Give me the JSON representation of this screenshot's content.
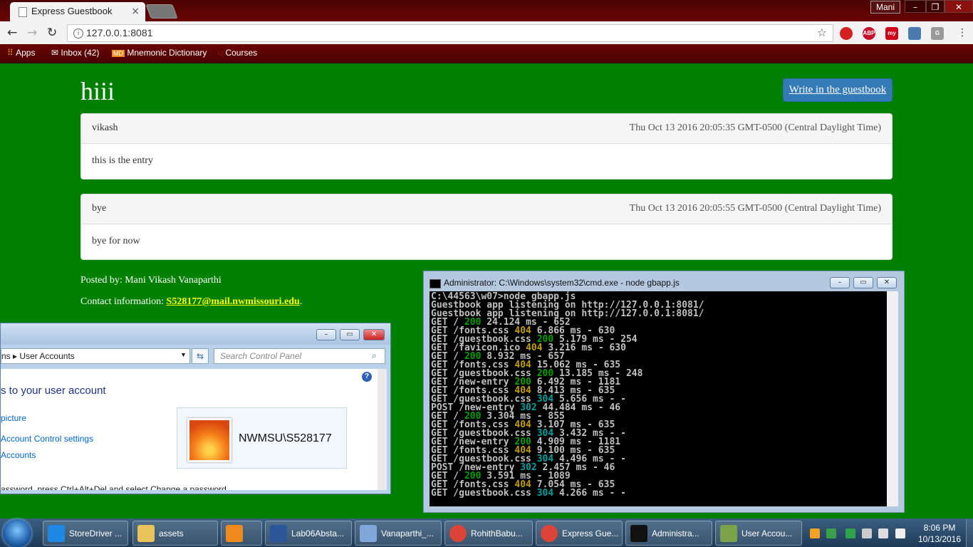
{
  "browser": {
    "tab_title": "Express Guestbook",
    "tab_close": "×",
    "user": "Mani",
    "url": "127.0.0.1:8081",
    "bookmarks": [
      {
        "label": "Apps"
      },
      {
        "label": "Inbox (42)"
      },
      {
        "label": "Mnemonic Dictionary"
      },
      {
        "label": "Courses"
      }
    ],
    "extensions": [
      "ABP",
      "my",
      "G"
    ]
  },
  "page": {
    "title": "hiii",
    "write_button": "Write in the guestbook",
    "entries": [
      {
        "name": "vikash",
        "date": "Thu Oct 13 2016 20:05:35 GMT-0500 (Central Daylight Time)",
        "body": "this is the entry"
      },
      {
        "name": "bye",
        "date": "Thu Oct 13 2016 20:05:55 GMT-0500 (Central Daylight Time)",
        "body": "bye for now"
      }
    ],
    "posted_by": "Posted by: Mani Vikash Vanaparthi",
    "contact_label": "Contact information: ",
    "contact_email": "S528177@mail.nwmissouri.edu",
    "contact_suffix": "."
  },
  "control_panel": {
    "breadcrumb_prefix": "ns",
    "breadcrumb_sep": "▸",
    "breadcrumb": "User Accounts",
    "search_placeholder": "Search Control Panel",
    "heading": "s to your user account",
    "links": [
      "picture",
      "Account Control settings",
      "Accounts"
    ],
    "bottom_text": "assword, press Ctrl+Alt+Del and select Change a password.",
    "account_name": "NWMSU\\S528177"
  },
  "cmd": {
    "title": "Administrator: C:\\Windows\\system32\\cmd.exe - node  gbapp.js",
    "lines": [
      {
        "text": "C:\\44563\\w07>node gbapp.js"
      },
      {
        "text": "Guestbook app listening on http://127.0.0.1:8081/"
      },
      {
        "text": "Guestbook app listening on http://127.0.0.1:8081/"
      },
      {
        "pre": "GET / ",
        "code": "200",
        "post": " 24.124 ms - 652"
      },
      {
        "pre": "GET /fonts.css ",
        "code": "404",
        "post": " 6.866 ms - 630"
      },
      {
        "pre": "GET /guestbook.css ",
        "code": "200",
        "post": " 5.179 ms - 254"
      },
      {
        "pre": "GET /favicon.ico ",
        "code": "404",
        "post": " 3.216 ms - 630"
      },
      {
        "pre": "GET / ",
        "code": "200",
        "post": " 8.932 ms - 657"
      },
      {
        "pre": "GET /fonts.css ",
        "code": "404",
        "post": " 15.062 ms - 635"
      },
      {
        "pre": "GET /guestbook.css ",
        "code": "200",
        "post": " 13.185 ms - 248"
      },
      {
        "pre": "GET /new-entry ",
        "code": "200",
        "post": " 6.492 ms - 1181"
      },
      {
        "pre": "GET /fonts.css ",
        "code": "404",
        "post": " 8.413 ms - 635"
      },
      {
        "pre": "GET /guestbook.css ",
        "code": "304",
        "post": " 5.656 ms - -"
      },
      {
        "pre": "POST /new-entry ",
        "code": "302",
        "post": " 44.484 ms - 46"
      },
      {
        "pre": "GET / ",
        "code": "200",
        "post": " 3.304 ms - 855"
      },
      {
        "pre": "GET /fonts.css ",
        "code": "404",
        "post": " 3.107 ms - 635"
      },
      {
        "pre": "GET /guestbook.css ",
        "code": "304",
        "post": " 3.432 ms - -"
      },
      {
        "pre": "GET /new-entry ",
        "code": "200",
        "post": " 4.909 ms - 1181"
      },
      {
        "pre": "GET /fonts.css ",
        "code": "404",
        "post": " 9.100 ms - 635"
      },
      {
        "pre": "GET /guestbook.css ",
        "code": "304",
        "post": " 4.496 ms - -"
      },
      {
        "pre": "POST /new-entry ",
        "code": "302",
        "post": " 2.457 ms - 46"
      },
      {
        "pre": "GET / ",
        "code": "200",
        "post": " 3.591 ms - 1089"
      },
      {
        "pre": "GET /fonts.css ",
        "code": "404",
        "post": " 7.054 ms - 635"
      },
      {
        "pre": "GET /guestbook.css ",
        "code": "304",
        "post": " 4.266 ms - -"
      }
    ]
  },
  "taskbar": {
    "items": [
      {
        "label": "StoreDriver ...",
        "icon": "internet-explorer-icon",
        "color": "#1e88e5"
      },
      {
        "label": "assets",
        "icon": "folder-icon",
        "color": "#e8c35a"
      },
      {
        "label": "",
        "icon": "media-player-icon",
        "color": "#f08a1c"
      },
      {
        "label": "Lab06Absta...",
        "icon": "word-icon",
        "color": "#2b579a"
      },
      {
        "label": "Vanaparthi_...",
        "icon": "virtualbox-icon",
        "color": "#7fa7d9"
      },
      {
        "label": "RohithBabu...",
        "icon": "chrome-icon",
        "color": "#db4437"
      },
      {
        "label": "Express Gue...",
        "icon": "chrome-icon",
        "color": "#db4437"
      },
      {
        "label": "Administra...",
        "icon": "cmd-icon",
        "color": "#111111"
      },
      {
        "label": "User Accou...",
        "icon": "user-accounts-icon",
        "color": "#7da34a"
      }
    ],
    "time": "8:06 PM",
    "date": "10/13/2016"
  },
  "colors": {
    "page_bg": "#008000",
    "button": "#337ab7",
    "email": "#ffff00"
  }
}
